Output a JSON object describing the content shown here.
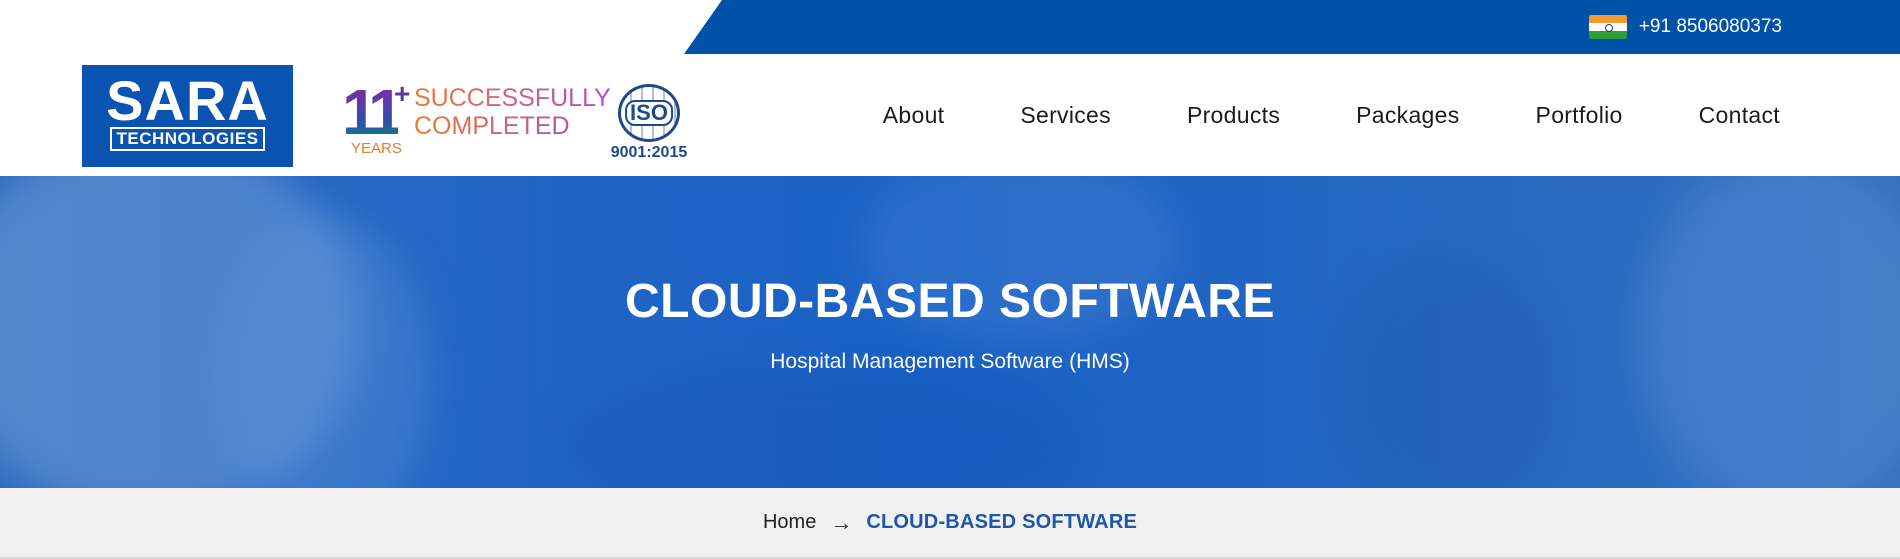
{
  "topbar": {
    "phone": "+91 8506080373"
  },
  "logo": {
    "line1": "SARA",
    "line2": "TECHNOLOGIES"
  },
  "badge": {
    "number": "11",
    "plus": "+",
    "years": "YEARS",
    "line1": "SUCCESSFULLY",
    "line2": "COMPLETED"
  },
  "iso": {
    "label": "ISO",
    "number": "9001:2015"
  },
  "nav": {
    "items": [
      "About",
      "Services",
      "Products",
      "Packages",
      "Portfolio",
      "Contact"
    ]
  },
  "hero": {
    "title": "CLOUD-BASED SOFTWARE",
    "subtitle": "Hospital Management Software (HMS)"
  },
  "breadcrumb": {
    "home": "Home",
    "current": "CLOUD-BASED SOFTWARE"
  },
  "colors": {
    "brand_blue": "#0051a8",
    "breadcrumb_active": "#1d57a8"
  }
}
